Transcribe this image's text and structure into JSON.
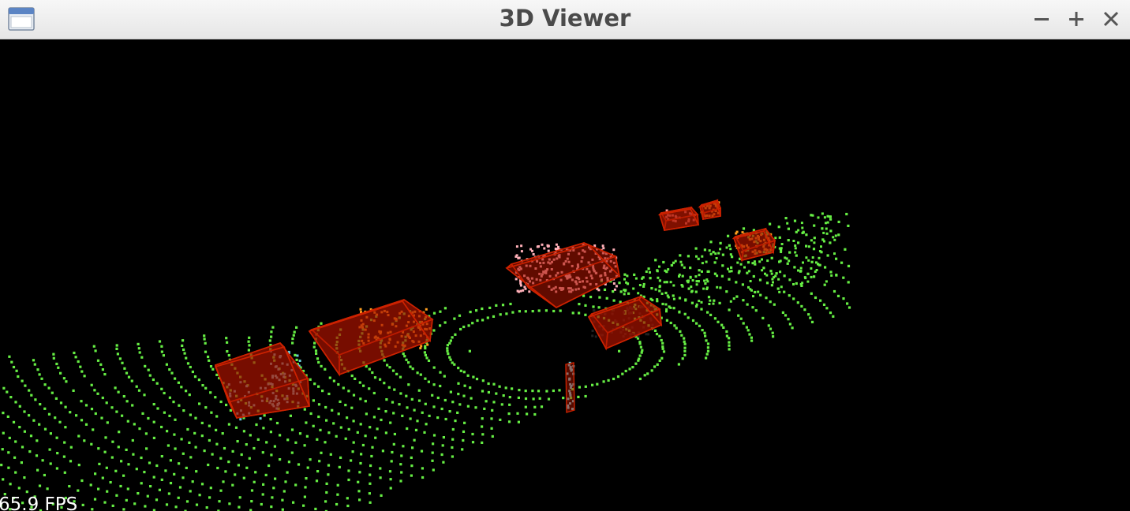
{
  "window": {
    "title": "3D Viewer",
    "icon": "app-window-icon",
    "controls": {
      "minimize": "minimize-icon",
      "maximize": "maximize-icon",
      "close": "close-icon"
    }
  },
  "viewport": {
    "background_color": "#000000",
    "fps_text": "65.9 FPS",
    "colors": {
      "ground_points": "#66ee44",
      "bbox_edge": "#cc2200",
      "bbox_fill": "#aa1500",
      "object_points_car": "#ffa020",
      "object_points_pedestrian": "#66c8d8",
      "object_points_highlight": "#ffb0b8"
    },
    "objects": [
      "car-box-near-left",
      "car-box-left",
      "car-box-center",
      "car-box-right",
      "car-box-far",
      "car-box-far-right",
      "pedestrian-pole"
    ]
  }
}
